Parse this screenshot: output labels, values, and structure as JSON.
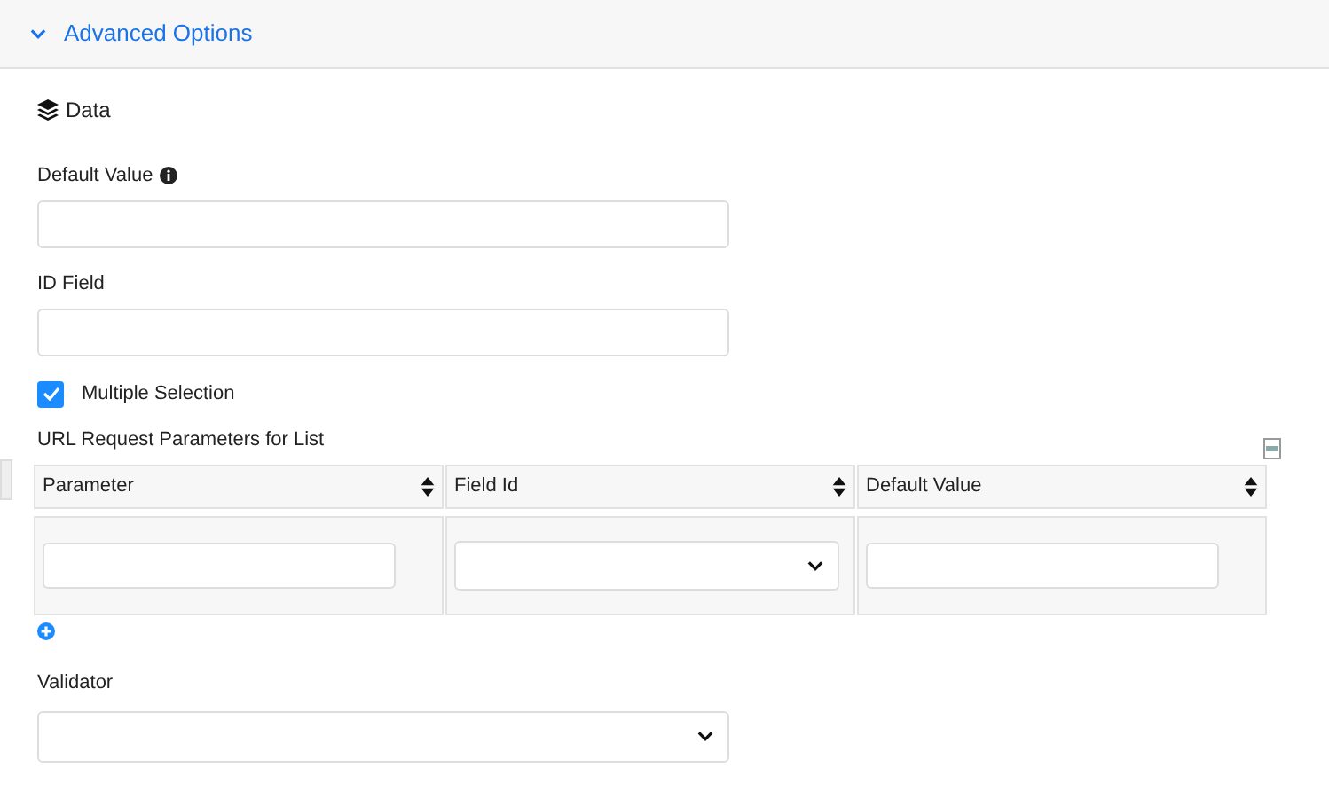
{
  "section": {
    "title": "Advanced Options",
    "expanded": true
  },
  "group_title": "Data",
  "fields": [
    {
      "label": "Default Value",
      "info": true
    },
    {
      "label": "ID Field",
      "info": false
    }
  ],
  "multiple_selection": {
    "label": "Multiple Selection",
    "checked": true
  },
  "params_table": {
    "title": "URL Request Parameters for List",
    "columns": [
      "Parameter",
      "Field Id",
      "Default Value"
    ],
    "row": [
      {
        "kind": "text"
      },
      {
        "kind": "select"
      },
      {
        "kind": "text"
      }
    ]
  },
  "validator": {
    "label": "Validator"
  }
}
